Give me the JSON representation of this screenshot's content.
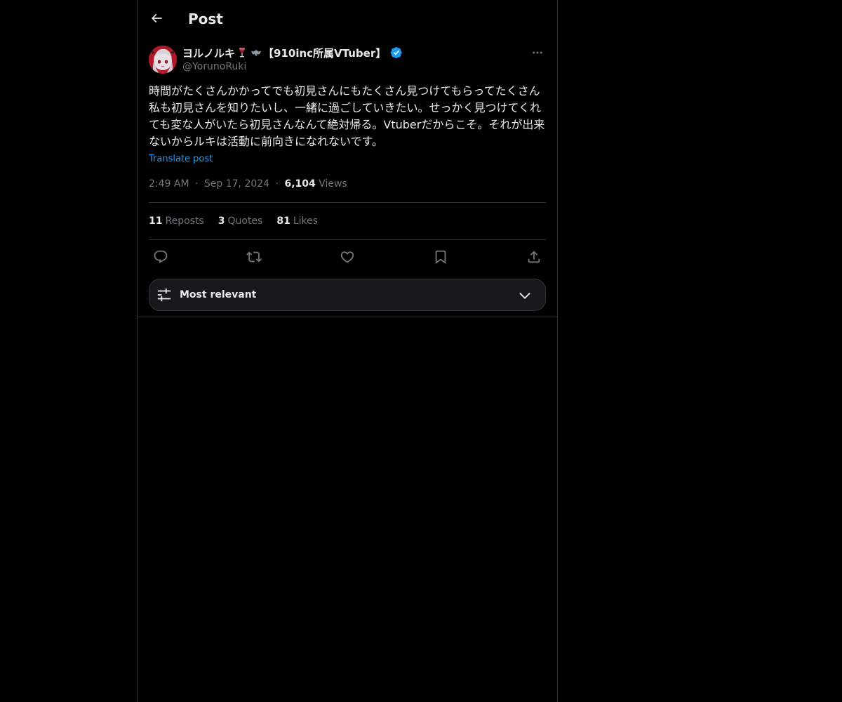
{
  "header": {
    "title": "Post",
    "back_icon": "arrow-left-icon"
  },
  "author": {
    "display_name_part1": "ヨルノルキ",
    "emoji_1": "wine-glass-icon",
    "emoji_2": "bat-icon",
    "display_name_part2": "【910inc所属VTuber】",
    "verified_color": "#1d9bf0",
    "handle": "@YorunoRuki"
  },
  "post": {
    "text": "時間がたくさんかかってでも初見さんにもたくさん見つけてもらってたくさん私も初見さんを知りたいし、一緒に過ごしていきたい。せっかく見つけてくれても変な人がいたら初見さんなんて絶対帰る。Vtuberだからこそ。それが出来ないからルキは活動に前向きになれないです。",
    "translate_label": "Translate post",
    "time": "2:49 AM",
    "sep1": "·",
    "date": "Sep 17, 2024",
    "sep2": "·",
    "views_count": "6,104",
    "views_label": "Views"
  },
  "stats": {
    "reposts_count": "11",
    "reposts_label": "Reposts",
    "quotes_count": "3",
    "quotes_label": "Quotes",
    "likes_count": "81",
    "likes_label": "Likes"
  },
  "actions": {
    "reply_icon": "reply-icon",
    "repost_icon": "repost-icon",
    "like_icon": "heart-icon",
    "bookmark_icon": "bookmark-icon",
    "share_icon": "share-icon"
  },
  "sort": {
    "label": "Most relevant"
  },
  "colors": {
    "background": "#000000",
    "text": "#e7e9ea",
    "muted": "#71767b",
    "accent": "#1d9bf0",
    "border": "#2f3336"
  }
}
